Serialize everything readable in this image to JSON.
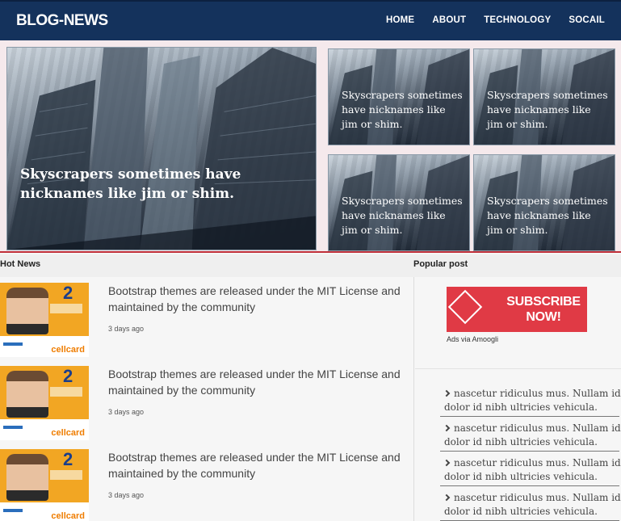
{
  "header": {
    "logo": "BLOG-NEWS",
    "nav": [
      "HOME",
      "ABOUT",
      "TECHNOLOGY",
      "SOCAIL"
    ]
  },
  "hero": {
    "main_caption": "Skyscrapers sometimes have nicknames like jim or shim.",
    "tiles": [
      {
        "caption": "Skyscrapers sometimes have nicknames like jim or shim."
      },
      {
        "caption": "Skyscrapers sometimes have nicknames like jim or shim."
      },
      {
        "caption": "Skyscrapers sometimes have nicknames like jim or shim."
      },
      {
        "caption": "Skyscrapers sometimes have nicknames like jim or shim."
      }
    ]
  },
  "sections": {
    "hot_news": "Hot News",
    "popular_post": "Popular post"
  },
  "news": [
    {
      "title": "Bootstrap themes are released under the MIT License and maintained by the community",
      "time": "3 days ago",
      "thumb_number": "2",
      "thumb_brand": "cellcard"
    },
    {
      "title": "Bootstrap themes are released under the MIT License and maintained by the community",
      "time": "3 days ago",
      "thumb_number": "2",
      "thumb_brand": "cellcard"
    },
    {
      "title": "Bootstrap themes are released under the MIT License and maintained by the community",
      "time": "3 days ago",
      "thumb_number": "2",
      "thumb_brand": "cellcard"
    }
  ],
  "sidebar": {
    "ad_text": "SUBSCRIBE NOW!",
    "ad_note": "Ads via Amoogli",
    "popular": [
      "nascetur ridiculus mus. Nullam id dolor id nibh ultricies vehicula.",
      "nascetur ridiculus mus. Nullam id dolor id nibh ultricies vehicula.",
      "nascetur ridiculus mus. Nullam id dolor id nibh ultricies vehicula.",
      "nascetur ridiculus mus. Nullam id dolor id nibh ultricies vehicula."
    ]
  },
  "colors": {
    "header_bg": "#14325c",
    "accent_red": "#c0303a",
    "ad_red": "#e03a45",
    "hero_bg": "#f5e9ec"
  }
}
